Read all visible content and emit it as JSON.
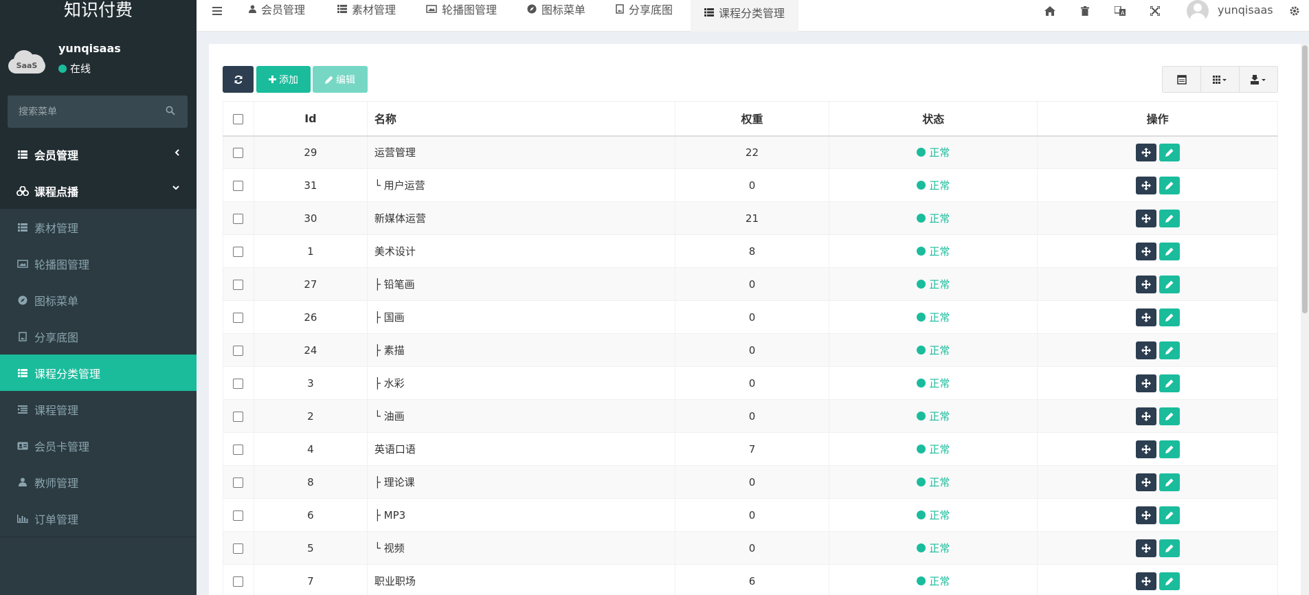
{
  "app": {
    "logo": "知识付费"
  },
  "user": {
    "name": "yunqisaas",
    "status": "在线",
    "avatar_text": "SaaS"
  },
  "search": {
    "placeholder": "搜索菜单"
  },
  "sidebar": {
    "items": [
      {
        "label": "会员管理",
        "icon": "list-icon",
        "level": "top",
        "arrow": "chevron-left"
      },
      {
        "label": "课程点播",
        "icon": "cubes-icon",
        "level": "top",
        "arrow": "chevron-down"
      },
      {
        "label": "素材管理",
        "icon": "list-icon",
        "level": "sub"
      },
      {
        "label": "轮播图管理",
        "icon": "image-icon",
        "level": "sub"
      },
      {
        "label": "图标菜单",
        "icon": "compass-icon",
        "level": "sub"
      },
      {
        "label": "分享底图",
        "icon": "file-image-icon",
        "level": "sub"
      },
      {
        "label": "课程分类管理",
        "icon": "list-icon",
        "level": "sub",
        "active": true
      },
      {
        "label": "课程管理",
        "icon": "indent-icon",
        "level": "sub"
      },
      {
        "label": "会员卡管理",
        "icon": "id-card-icon",
        "level": "sub"
      },
      {
        "label": "教师管理",
        "icon": "user-icon",
        "level": "sub"
      },
      {
        "label": "订单管理",
        "icon": "bar-chart-icon",
        "level": "sub"
      }
    ]
  },
  "tabs": [
    {
      "label": "会员管理",
      "icon": "user-icon"
    },
    {
      "label": "素材管理",
      "icon": "list-icon"
    },
    {
      "label": "轮播图管理",
      "icon": "image-icon"
    },
    {
      "label": "图标菜单",
      "icon": "compass-icon"
    },
    {
      "label": "分享底图",
      "icon": "file-image-icon"
    },
    {
      "label": "课程分类管理",
      "icon": "list-icon",
      "active": true
    }
  ],
  "topbar": {
    "username": "yunqisaas"
  },
  "toolbar": {
    "add_label": "添加",
    "edit_label": "编辑"
  },
  "table": {
    "headers": {
      "id": "Id",
      "name": "名称",
      "weight": "权重",
      "status": "状态",
      "ops": "操作"
    },
    "rows": [
      {
        "id": "29",
        "name": "运营管理",
        "weight": "22",
        "status": "正常"
      },
      {
        "id": "31",
        "name": "└ 用户运营",
        "weight": "0",
        "status": "正常"
      },
      {
        "id": "30",
        "name": "新媒体运营",
        "weight": "21",
        "status": "正常"
      },
      {
        "id": "1",
        "name": "美术设计",
        "weight": "8",
        "status": "正常"
      },
      {
        "id": "27",
        "name": "├ 铅笔画",
        "weight": "0",
        "status": "正常"
      },
      {
        "id": "26",
        "name": "├ 国画",
        "weight": "0",
        "status": "正常"
      },
      {
        "id": "24",
        "name": "├ 素描",
        "weight": "0",
        "status": "正常"
      },
      {
        "id": "3",
        "name": "├ 水彩",
        "weight": "0",
        "status": "正常"
      },
      {
        "id": "2",
        "name": "└ 油画",
        "weight": "0",
        "status": "正常"
      },
      {
        "id": "4",
        "name": "英语口语",
        "weight": "7",
        "status": "正常"
      },
      {
        "id": "8",
        "name": "├ 理论课",
        "weight": "0",
        "status": "正常"
      },
      {
        "id": "6",
        "name": "├ MP3",
        "weight": "0",
        "status": "正常"
      },
      {
        "id": "5",
        "name": "└ 视频",
        "weight": "0",
        "status": "正常"
      },
      {
        "id": "7",
        "name": "职业职场",
        "weight": "6",
        "status": "正常"
      }
    ]
  },
  "colors": {
    "accent": "#1abc9c",
    "dark": "#2c3e50",
    "sidebar": "#222d32"
  }
}
